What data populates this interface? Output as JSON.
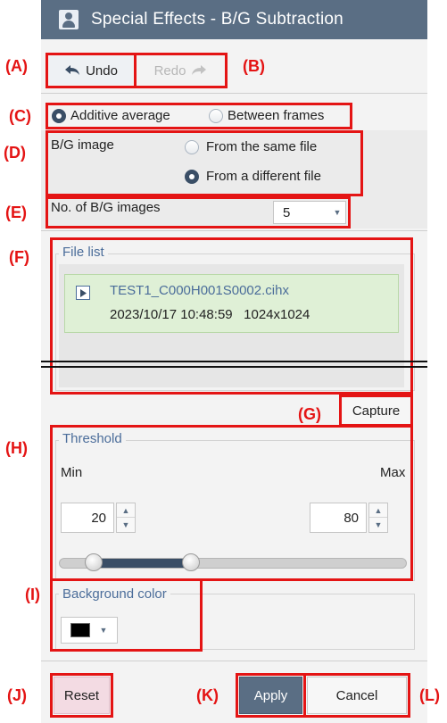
{
  "window": {
    "title": "Special Effects - B/G Subtraction"
  },
  "callouts": {
    "a": "(A)",
    "b": "(B)",
    "c": "(C)",
    "d": "(D)",
    "e": "(E)",
    "f": "(F)",
    "g": "(G)",
    "h": "(H)",
    "i": "(I)",
    "j": "(J)",
    "k": "(K)",
    "l": "(L)"
  },
  "toolbar": {
    "undo_label": "Undo",
    "redo_label": "Redo"
  },
  "mode": {
    "options": [
      "Additive average",
      "Between frames"
    ],
    "selected": "Additive average"
  },
  "bg_image": {
    "label": "B/G image",
    "options": [
      "From the same file",
      "From a different file"
    ],
    "selected": "From a different file"
  },
  "bg_count": {
    "label": "No. of B/G images",
    "value": "5"
  },
  "file_list": {
    "title": "File list",
    "items": [
      {
        "name": "TEST1_C000H001S0002.cihx",
        "details": "2023/10/17 10:48:59   1024x1024"
      }
    ]
  },
  "capture_label": "Capture",
  "threshold": {
    "title": "Threshold",
    "min_label": "Min",
    "max_label": "Max",
    "min_value": "20",
    "max_value": "80",
    "slider_min_fraction": 0.1,
    "slider_max_fraction": 0.38
  },
  "background_color": {
    "title": "Background color",
    "value": "#000000"
  },
  "actions": {
    "reset_label": "Reset",
    "apply_label": "Apply",
    "cancel_label": "Cancel"
  },
  "colors": {
    "accent": "#4b6d9a",
    "title_bar": "#5a6e84",
    "callout": "#e41414",
    "file_item_bg": "#dff0d6",
    "apply_bg": "#5a6e84"
  },
  "icons": [
    "user-icon",
    "undo-arrow-icon",
    "redo-arrow-icon",
    "play-file-icon",
    "chevron-up-icon",
    "chevron-down-icon"
  ]
}
